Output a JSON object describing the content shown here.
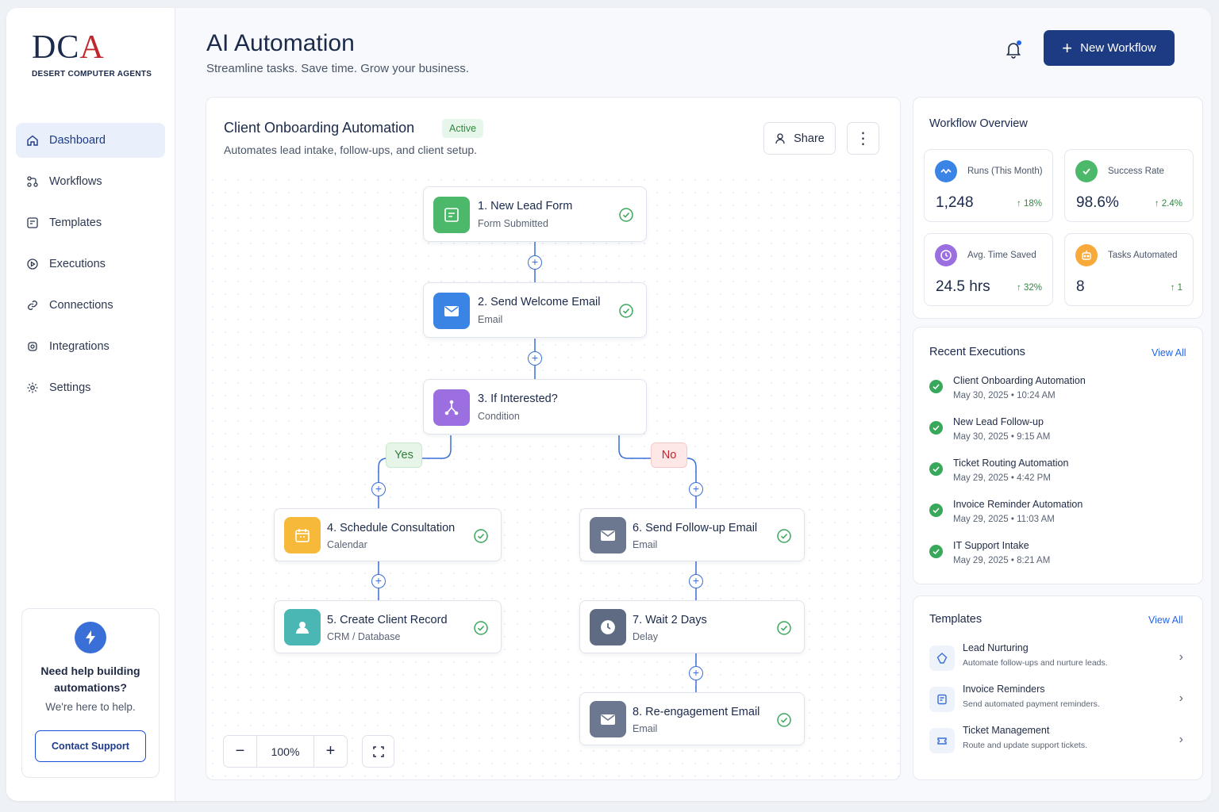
{
  "brand": {
    "mark_left": "DC",
    "mark_right": "A",
    "name": "DESERT COMPUTER AGENTS"
  },
  "sidebar": {
    "items": [
      {
        "label": "Dashboard",
        "icon": "home-icon"
      },
      {
        "label": "Workflows",
        "icon": "workflow-icon"
      },
      {
        "label": "Templates",
        "icon": "template-icon"
      },
      {
        "label": "Executions",
        "icon": "play-icon"
      },
      {
        "label": "Connections",
        "icon": "link-icon"
      },
      {
        "label": "Integrations",
        "icon": "gear-icon"
      },
      {
        "label": "Settings",
        "icon": "settings-icon"
      }
    ],
    "help": {
      "title": "Need help building automations?",
      "subtitle": "We're here to help.",
      "button": "Contact Support"
    }
  },
  "header": {
    "title": "AI Automation",
    "subtitle": "Streamline tasks. Save time. Grow your business.",
    "new_button": "New Workflow"
  },
  "workflow": {
    "title": "Client Onboarding Automation",
    "status": "Active",
    "description": "Automates lead intake, follow-ups, and client setup.",
    "share": "Share",
    "nodes": [
      {
        "title": "1. New Lead Form",
        "subtitle": "Form Submitted",
        "color": "#4cb86a",
        "icon": "form-icon"
      },
      {
        "title": "2. Send Welcome Email",
        "subtitle": "Email",
        "color": "#3a84e6",
        "icon": "email-icon"
      },
      {
        "title": "3. If Interested?",
        "subtitle": "Condition",
        "color": "#9b6fe0",
        "icon": "branch-icon"
      },
      {
        "title": "4. Schedule Consultation",
        "subtitle": "Calendar",
        "color": "#f7b93a",
        "icon": "calendar-icon"
      },
      {
        "title": "5. Create Client Record",
        "subtitle": "CRM / Database",
        "color": "#4ab7b4",
        "icon": "user-icon"
      },
      {
        "title": "6. Send Follow-up Email",
        "subtitle": "Email",
        "color": "#6b7890",
        "icon": "email-icon"
      },
      {
        "title": "7. Wait 2 Days",
        "subtitle": "Delay",
        "color": "#5e6b82",
        "icon": "clock-icon"
      },
      {
        "title": "8. Re-engagement Email",
        "subtitle": "Email",
        "color": "#6b7890",
        "icon": "email-icon"
      }
    ],
    "branch_yes": "Yes",
    "branch_no": "No",
    "zoom": "100%"
  },
  "overview": {
    "title": "Workflow Overview",
    "stats": [
      {
        "label": "Runs (This Month)",
        "value": "1,248",
        "delta": "↑ 18%",
        "color": "#3a84e6"
      },
      {
        "label": "Success Rate",
        "value": "98.6%",
        "delta": "↑ 2.4%",
        "color": "#4cb86a"
      },
      {
        "label": "Avg. Time Saved",
        "value": "24.5 hrs",
        "delta": "↑ 32%",
        "color": "#9b6fe0"
      },
      {
        "label": "Tasks Automated",
        "value": "8",
        "delta": "↑ 1",
        "color": "#f7a93a"
      }
    ]
  },
  "executions": {
    "title": "Recent Executions",
    "view_all": "View All",
    "items": [
      {
        "name": "Client Onboarding Automation",
        "date": "May 30, 2025  •  10:24 AM"
      },
      {
        "name": "New Lead Follow-up",
        "date": "May 30, 2025  •  9:15 AM"
      },
      {
        "name": "Ticket Routing Automation",
        "date": "May 29, 2025  •  4:42 PM"
      },
      {
        "name": "Invoice Reminder Automation",
        "date": "May 29, 2025  •  11:03 AM"
      },
      {
        "name": "IT Support Intake",
        "date": "May 29, 2025  •  8:21 AM"
      }
    ]
  },
  "templates": {
    "title": "Templates",
    "view_all": "View All",
    "items": [
      {
        "name": "Lead Nurturing",
        "desc": "Automate follow-ups and nurture leads."
      },
      {
        "name": "Invoice Reminders",
        "desc": "Send automated payment reminders."
      },
      {
        "name": "Ticket Management",
        "desc": "Route and update support tickets."
      }
    ]
  }
}
